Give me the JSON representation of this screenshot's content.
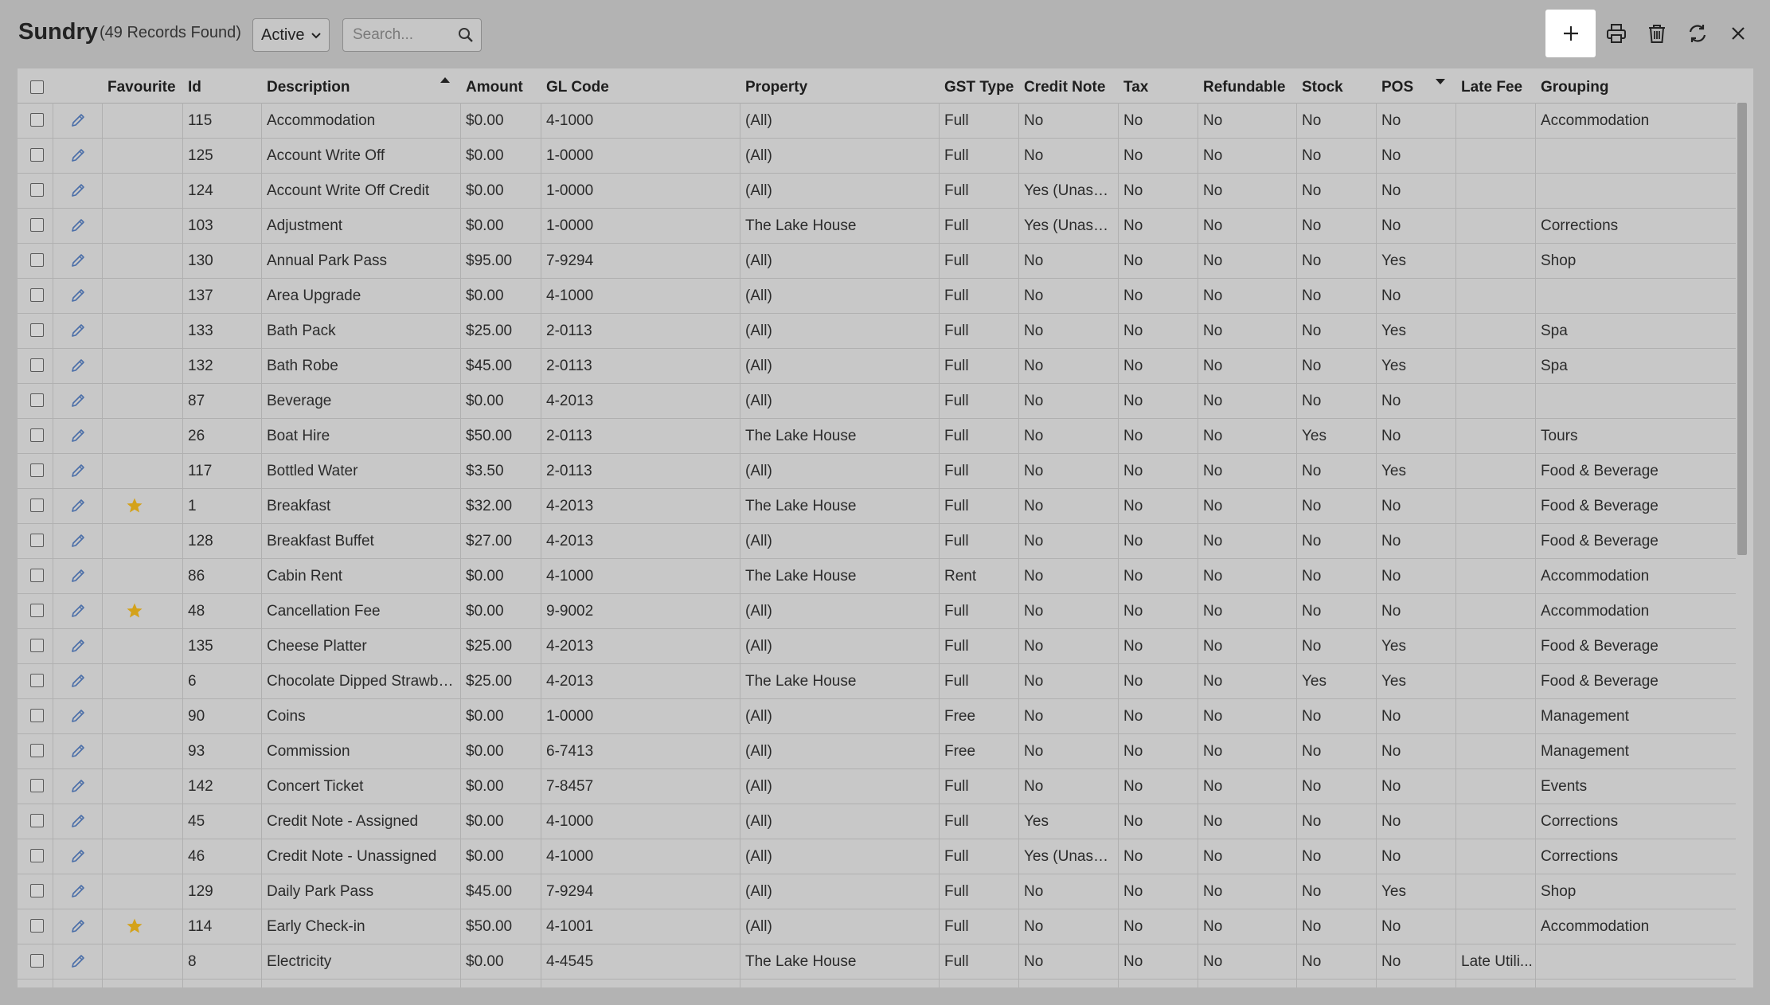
{
  "header": {
    "title": "Sundry",
    "record_count": "(49 Records Found)",
    "status_filter": "Active",
    "search_placeholder": "Search..."
  },
  "toolbar": {
    "add": "plus-icon",
    "print": "printer-icon",
    "delete": "trash-icon",
    "refresh": "refresh-icon",
    "close": "close-icon"
  },
  "columns": [
    "Favourite",
    "Id",
    "Description",
    "Amount",
    "GL Code",
    "Property",
    "GST Type",
    "Credit Note",
    "Tax",
    "Refundable",
    "Stock",
    "POS",
    "Late Fee",
    "Grouping"
  ],
  "sort": {
    "ascending_column": "Description",
    "dropdown_column": "POS"
  },
  "colors": {
    "star": "#d4a21a",
    "edit": "#4a6ea8",
    "add_button_bg": "#ffffff"
  },
  "rows": [
    {
      "fav": false,
      "id": "115",
      "description": "Accommodation",
      "amount": "$0.00",
      "gl_code": "4-1000",
      "property": "(All)",
      "gst_type": "Full",
      "credit_note": "No",
      "tax": "No",
      "refundable": "No",
      "stock": "No",
      "pos": "No",
      "late_fee": "",
      "grouping": "Accommodation"
    },
    {
      "fav": false,
      "id": "125",
      "description": "Account Write Off",
      "amount": "$0.00",
      "gl_code": "1-0000",
      "property": "(All)",
      "gst_type": "Full",
      "credit_note": "No",
      "tax": "No",
      "refundable": "No",
      "stock": "No",
      "pos": "No",
      "late_fee": "",
      "grouping": ""
    },
    {
      "fav": false,
      "id": "124",
      "description": "Account Write Off Credit",
      "amount": "$0.00",
      "gl_code": "1-0000",
      "property": "(All)",
      "gst_type": "Full",
      "credit_note": "Yes (Unassi...",
      "tax": "No",
      "refundable": "No",
      "stock": "No",
      "pos": "No",
      "late_fee": "",
      "grouping": ""
    },
    {
      "fav": false,
      "id": "103",
      "description": "Adjustment",
      "amount": "$0.00",
      "gl_code": "1-0000",
      "property": "The Lake House",
      "gst_type": "Full",
      "credit_note": "Yes (Unassi...",
      "tax": "No",
      "refundable": "No",
      "stock": "No",
      "pos": "No",
      "late_fee": "",
      "grouping": "Corrections"
    },
    {
      "fav": false,
      "id": "130",
      "description": "Annual Park Pass",
      "amount": "$95.00",
      "gl_code": "7-9294",
      "property": "(All)",
      "gst_type": "Full",
      "credit_note": "No",
      "tax": "No",
      "refundable": "No",
      "stock": "No",
      "pos": "Yes",
      "late_fee": "",
      "grouping": "Shop"
    },
    {
      "fav": false,
      "id": "137",
      "description": "Area Upgrade",
      "amount": "$0.00",
      "gl_code": "4-1000",
      "property": "(All)",
      "gst_type": "Full",
      "credit_note": "No",
      "tax": "No",
      "refundable": "No",
      "stock": "No",
      "pos": "No",
      "late_fee": "",
      "grouping": ""
    },
    {
      "fav": false,
      "id": "133",
      "description": "Bath Pack",
      "amount": "$25.00",
      "gl_code": "2-0113",
      "property": "(All)",
      "gst_type": "Full",
      "credit_note": "No",
      "tax": "No",
      "refundable": "No",
      "stock": "No",
      "pos": "Yes",
      "late_fee": "",
      "grouping": "Spa"
    },
    {
      "fav": false,
      "id": "132",
      "description": "Bath Robe",
      "amount": "$45.00",
      "gl_code": "2-0113",
      "property": "(All)",
      "gst_type": "Full",
      "credit_note": "No",
      "tax": "No",
      "refundable": "No",
      "stock": "No",
      "pos": "Yes",
      "late_fee": "",
      "grouping": "Spa"
    },
    {
      "fav": false,
      "id": "87",
      "description": "Beverage",
      "amount": "$0.00",
      "gl_code": "4-2013",
      "property": "(All)",
      "gst_type": "Full",
      "credit_note": "No",
      "tax": "No",
      "refundable": "No",
      "stock": "No",
      "pos": "No",
      "late_fee": "",
      "grouping": ""
    },
    {
      "fav": false,
      "id": "26",
      "description": "Boat Hire",
      "amount": "$50.00",
      "gl_code": "2-0113",
      "property": "The Lake House",
      "gst_type": "Full",
      "credit_note": "No",
      "tax": "No",
      "refundable": "No",
      "stock": "Yes",
      "pos": "No",
      "late_fee": "",
      "grouping": "Tours"
    },
    {
      "fav": false,
      "id": "117",
      "description": "Bottled Water",
      "amount": "$3.50",
      "gl_code": "2-0113",
      "property": "(All)",
      "gst_type": "Full",
      "credit_note": "No",
      "tax": "No",
      "refundable": "No",
      "stock": "No",
      "pos": "Yes",
      "late_fee": "",
      "grouping": "Food & Beverage"
    },
    {
      "fav": true,
      "id": "1",
      "description": "Breakfast",
      "amount": "$32.00",
      "gl_code": "4-2013",
      "property": "The Lake House",
      "gst_type": "Full",
      "credit_note": "No",
      "tax": "No",
      "refundable": "No",
      "stock": "No",
      "pos": "No",
      "late_fee": "",
      "grouping": "Food & Beverage"
    },
    {
      "fav": false,
      "id": "128",
      "description": "Breakfast Buffet",
      "amount": "$27.00",
      "gl_code": "4-2013",
      "property": "(All)",
      "gst_type": "Full",
      "credit_note": "No",
      "tax": "No",
      "refundable": "No",
      "stock": "No",
      "pos": "No",
      "late_fee": "",
      "grouping": "Food & Beverage"
    },
    {
      "fav": false,
      "id": "86",
      "description": "Cabin Rent",
      "amount": "$0.00",
      "gl_code": "4-1000",
      "property": "The Lake House",
      "gst_type": "Rent",
      "credit_note": "No",
      "tax": "No",
      "refundable": "No",
      "stock": "No",
      "pos": "No",
      "late_fee": "",
      "grouping": "Accommodation"
    },
    {
      "fav": true,
      "id": "48",
      "description": "Cancellation Fee",
      "amount": "$0.00",
      "gl_code": "9-9002",
      "property": "(All)",
      "gst_type": "Full",
      "credit_note": "No",
      "tax": "No",
      "refundable": "No",
      "stock": "No",
      "pos": "No",
      "late_fee": "",
      "grouping": "Accommodation"
    },
    {
      "fav": false,
      "id": "135",
      "description": "Cheese Platter",
      "amount": "$25.00",
      "gl_code": "4-2013",
      "property": "(All)",
      "gst_type": "Full",
      "credit_note": "No",
      "tax": "No",
      "refundable": "No",
      "stock": "No",
      "pos": "Yes",
      "late_fee": "",
      "grouping": "Food & Beverage"
    },
    {
      "fav": false,
      "id": "6",
      "description": "Chocolate Dipped Strawbe...",
      "amount": "$25.00",
      "gl_code": "4-2013",
      "property": "The Lake House",
      "gst_type": "Full",
      "credit_note": "No",
      "tax": "No",
      "refundable": "No",
      "stock": "Yes",
      "pos": "Yes",
      "late_fee": "",
      "grouping": "Food & Beverage"
    },
    {
      "fav": false,
      "id": "90",
      "description": "Coins",
      "amount": "$0.00",
      "gl_code": "1-0000",
      "property": "(All)",
      "gst_type": "Free",
      "credit_note": "No",
      "tax": "No",
      "refundable": "No",
      "stock": "No",
      "pos": "No",
      "late_fee": "",
      "grouping": "Management"
    },
    {
      "fav": false,
      "id": "93",
      "description": "Commission",
      "amount": "$0.00",
      "gl_code": "6-7413",
      "property": "(All)",
      "gst_type": "Free",
      "credit_note": "No",
      "tax": "No",
      "refundable": "No",
      "stock": "No",
      "pos": "No",
      "late_fee": "",
      "grouping": "Management"
    },
    {
      "fav": false,
      "id": "142",
      "description": "Concert Ticket",
      "amount": "$0.00",
      "gl_code": "7-8457",
      "property": "(All)",
      "gst_type": "Full",
      "credit_note": "No",
      "tax": "No",
      "refundable": "No",
      "stock": "No",
      "pos": "No",
      "late_fee": "",
      "grouping": "Events"
    },
    {
      "fav": false,
      "id": "45",
      "description": "Credit Note - Assigned",
      "amount": "$0.00",
      "gl_code": "4-1000",
      "property": "(All)",
      "gst_type": "Full",
      "credit_note": "Yes",
      "tax": "No",
      "refundable": "No",
      "stock": "No",
      "pos": "No",
      "late_fee": "",
      "grouping": "Corrections"
    },
    {
      "fav": false,
      "id": "46",
      "description": "Credit Note - Unassigned",
      "amount": "$0.00",
      "gl_code": "4-1000",
      "property": "(All)",
      "gst_type": "Full",
      "credit_note": "Yes (Unassi...",
      "tax": "No",
      "refundable": "No",
      "stock": "No",
      "pos": "No",
      "late_fee": "",
      "grouping": "Corrections"
    },
    {
      "fav": false,
      "id": "129",
      "description": "Daily Park Pass",
      "amount": "$45.00",
      "gl_code": "7-9294",
      "property": "(All)",
      "gst_type": "Full",
      "credit_note": "No",
      "tax": "No",
      "refundable": "No",
      "stock": "No",
      "pos": "Yes",
      "late_fee": "",
      "grouping": "Shop"
    },
    {
      "fav": true,
      "id": "114",
      "description": "Early Check-in",
      "amount": "$50.00",
      "gl_code": "4-1001",
      "property": "(All)",
      "gst_type": "Full",
      "credit_note": "No",
      "tax": "No",
      "refundable": "No",
      "stock": "No",
      "pos": "No",
      "late_fee": "",
      "grouping": "Accommodation"
    },
    {
      "fav": false,
      "id": "8",
      "description": "Electricity",
      "amount": "$0.00",
      "gl_code": "4-4545",
      "property": "The Lake House",
      "gst_type": "Full",
      "credit_note": "No",
      "tax": "No",
      "refundable": "No",
      "stock": "No",
      "pos": "No",
      "late_fee": "Late Utili...",
      "grouping": ""
    }
  ]
}
